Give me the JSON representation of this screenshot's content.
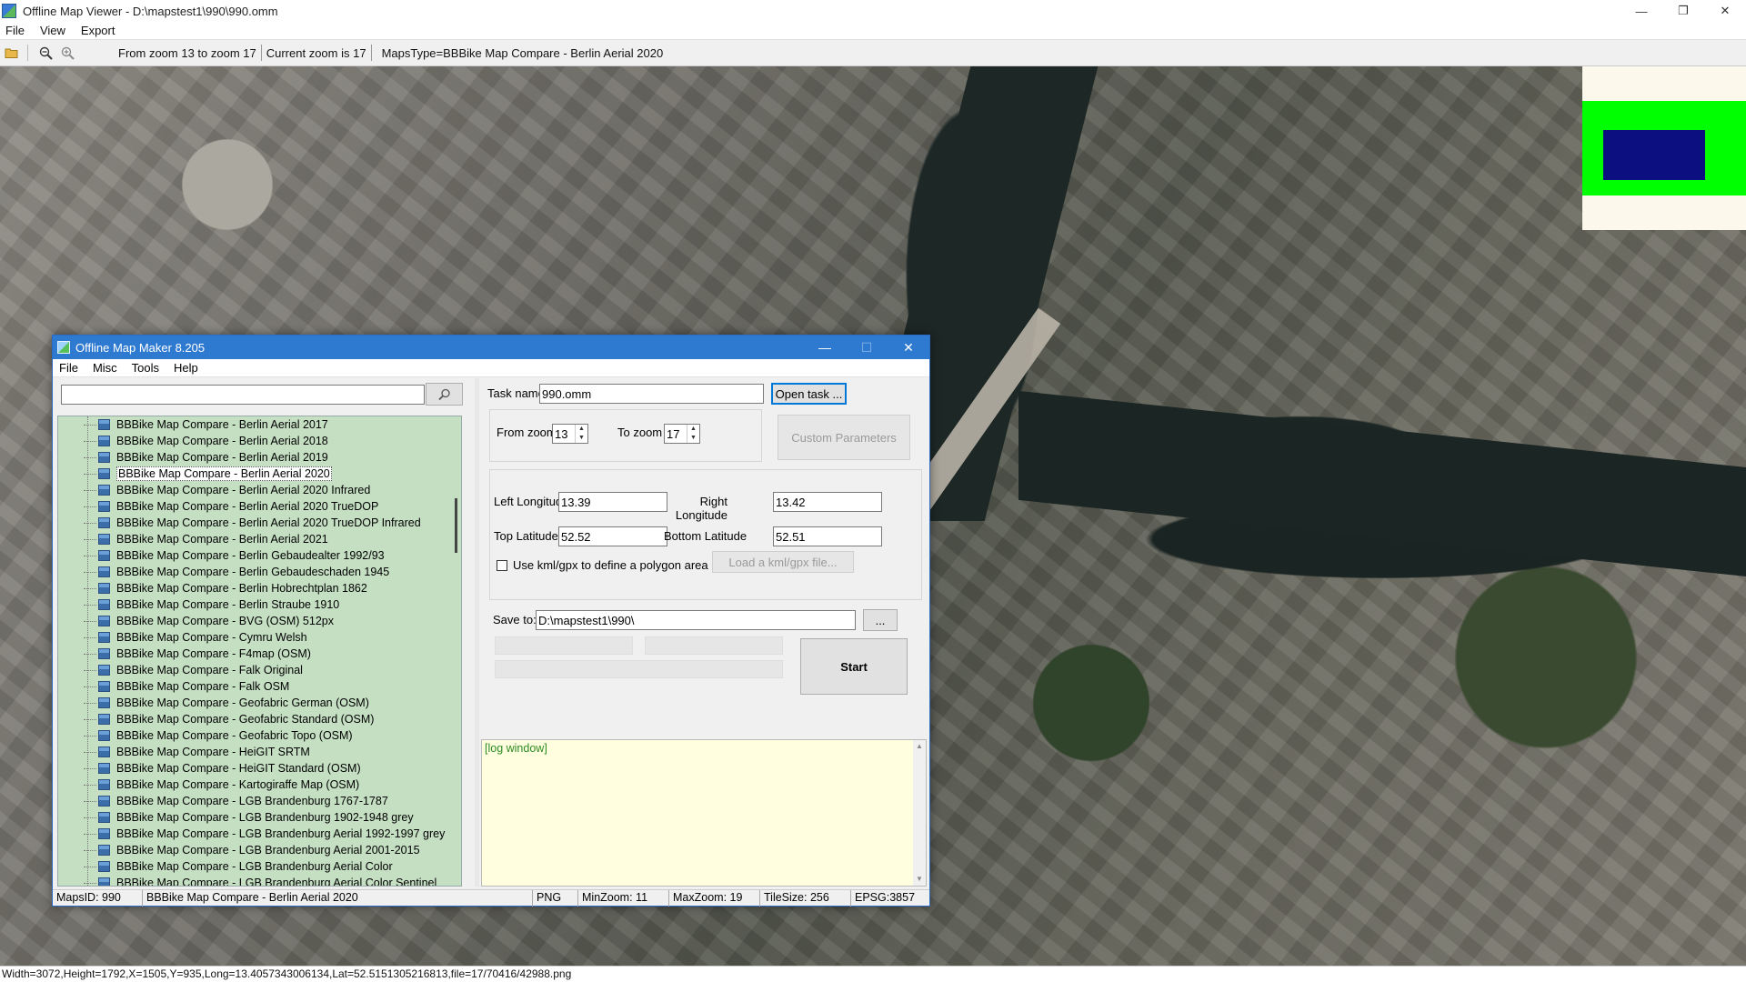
{
  "window": {
    "title": "Offline Map Viewer - D:\\mapstest1\\990\\990.omm",
    "controls": {
      "minimize": "—",
      "restore": "❐",
      "close": "✕"
    }
  },
  "menu": [
    "File",
    "View",
    "Export"
  ],
  "toolbar": {
    "zoom_range": "From zoom 13 to zoom 17",
    "current_zoom": "Current zoom is 17",
    "maps_type": "MapsType=BBBike Map Compare - Berlin Aerial 2020"
  },
  "status_bar": "Width=3072,Height=1792,X=1505,Y=935,Long=13.4057343006134,Lat=52.5151305216813,file=17/70416/42988.png",
  "dialog": {
    "title": "Offline Map Maker 8.205",
    "menu": [
      "File",
      "Misc",
      "Tools",
      "Help"
    ],
    "search": {
      "value": "",
      "button_icon": "magnifier-icon"
    },
    "tree_items": [
      "BBBike Map Compare - Berlin Aerial 2017",
      "BBBike Map Compare - Berlin Aerial 2018",
      "BBBike Map Compare - Berlin Aerial 2019",
      "BBBike Map Compare - Berlin Aerial 2020",
      "BBBike Map Compare - Berlin Aerial 2020 Infrared",
      "BBBike Map Compare - Berlin Aerial 2020 TrueDOP",
      "BBBike Map Compare - Berlin Aerial 2020 TrueDOP Infrared",
      "BBBike Map Compare - Berlin Aerial 2021",
      "BBBike Map Compare - Berlin Gebaudealter 1992/93",
      "BBBike Map Compare - Berlin Gebaudeschaden 1945",
      "BBBike Map Compare - Berlin Hobrechtplan 1862",
      "BBBike Map Compare - Berlin Straube 1910",
      "BBBike Map Compare - BVG (OSM) 512px",
      "BBBike Map Compare - Cymru Welsh",
      "BBBike Map Compare - F4map (OSM)",
      "BBBike Map Compare - Falk Original",
      "BBBike Map Compare - Falk OSM",
      "BBBike Map Compare - Geofabric German (OSM)",
      "BBBike Map Compare - Geofabric Standard (OSM)",
      "BBBike Map Compare - Geofabric Topo (OSM)",
      "BBBike Map Compare - HeiGIT SRTM",
      "BBBike Map Compare - HeiGIT Standard (OSM)",
      "BBBike Map Compare - Kartogiraffe Map (OSM)",
      "BBBike Map Compare - LGB Brandenburg 1767-1787",
      "BBBike Map Compare - LGB Brandenburg 1902-1948 grey",
      "BBBike Map Compare - LGB Brandenburg Aerial 1992-1997 grey",
      "BBBike Map Compare - LGB Brandenburg Aerial 2001-2015",
      "BBBike Map Compare - LGB Brandenburg Aerial Color",
      "BBBike Map Compare - LGB Brandenburg Aerial Color Sentinel"
    ],
    "selected_index": 3,
    "task_name_label": "Task name",
    "task_name": "990.omm",
    "open_task": "Open task ...",
    "from_zoom_label": "From zoom",
    "from_zoom": "13",
    "to_zoom_label": "To zoom",
    "to_zoom": "17",
    "custom_parameters": "Custom Parameters",
    "left_longitude_label": "Left Longitude",
    "left_longitude": "13.39",
    "right_longitude_label": "Right Longitude",
    "right_longitude": "13.42",
    "top_latitude_label": "Top Latitude",
    "top_latitude": "52.52",
    "bottom_latitude_label": "Bottom Latitude",
    "bottom_latitude": "52.51",
    "use_kml_label": "Use kml/gpx to define a polygon area",
    "load_kml": "Load a kml/gpx file...",
    "save_to_label": "Save to:",
    "save_to": "D:\\mapstest1\\990\\",
    "browse": "...",
    "start": "Start",
    "log": "[log window]",
    "status": {
      "maps_id": "MapsID: 990",
      "maps_name": "BBBike Map Compare - Berlin Aerial 2020",
      "format": "PNG",
      "min_zoom": "MinZoom: 11",
      "max_zoom": "MaxZoom: 19",
      "tile_size": "TileSize: 256",
      "epsg": "EPSG:3857"
    }
  }
}
